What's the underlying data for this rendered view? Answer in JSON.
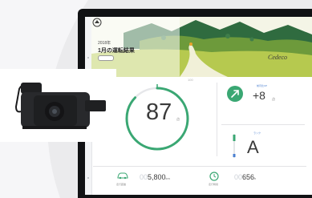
{
  "colors": {
    "background": "#ebebed",
    "tablet_frame": "#111214",
    "gauge_green": "#3aa773",
    "gauge_yellow": "#d8c632",
    "accent_blue": "#4a7fd0",
    "banner_sky": "#f4f5e6",
    "banner_mountain": "#2f6b3f",
    "banner_field": "#b6c94f"
  },
  "banner": {
    "year": "2018年",
    "title": "1月の運転結果",
    "chip": "",
    "brand": "Cedeco"
  },
  "gauge": {
    "value": "87",
    "unit": "点",
    "max_label": "100",
    "fraction": 0.87
  },
  "score_change": {
    "caption": "前月比UP",
    "value": "+8",
    "unit": "点",
    "icon": "arrow-up-right-icon"
  },
  "rank": {
    "caption": "ランク",
    "value": "A",
    "scale_top": "A",
    "scale_bottom": "E"
  },
  "stats": [
    {
      "icon": "car-icon",
      "label": "走行距離",
      "prefix": "00",
      "value": "5,800",
      "unit": "km"
    },
    {
      "icon": "clock-icon",
      "label": "走行時間",
      "prefix": "00",
      "value": "656",
      "unit": "h"
    }
  ],
  "device": {
    "name": "dashcam",
    "icon": "dashcam-icon"
  }
}
